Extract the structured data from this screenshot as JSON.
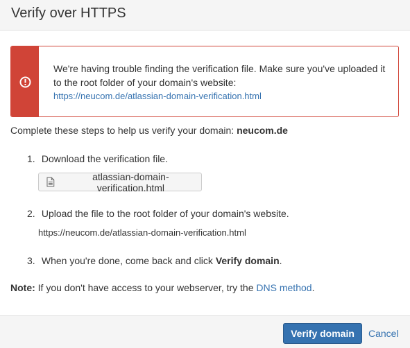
{
  "dialog": {
    "title": "Verify over HTTPS"
  },
  "error": {
    "message": "We're having trouble finding the verification file. Make sure you've uploaded it to the root folder of your domain's website:",
    "link": "https://neucom.de/atlassian-domain-verification.html",
    "icon": "exclamation-circle-icon",
    "color": "#d04437"
  },
  "intro": {
    "text": "Complete these steps to help us verify your domain:",
    "domain": "neucom.de"
  },
  "steps": [
    {
      "number": "1.",
      "text": "Download the verification file."
    },
    {
      "number": "2.",
      "text": "Upload the file to the root folder of your domain's website."
    },
    {
      "number": "3.",
      "text_before": "When you're done, come back and click",
      "text_bold": "Verify domain",
      "text_after": "."
    }
  ],
  "download_button": {
    "label": "atlassian-domain-verification.html",
    "icon": "file-icon"
  },
  "upload_url": "https://neucom.de/atlassian-domain-verification.html",
  "note": {
    "label": "Note:",
    "text": "If you don't have access to your webserver, try the",
    "link": "DNS method",
    "after": "."
  },
  "footer": {
    "verify_label": "Verify domain",
    "cancel_label": "Cancel",
    "primary_color": "#3572b0"
  }
}
